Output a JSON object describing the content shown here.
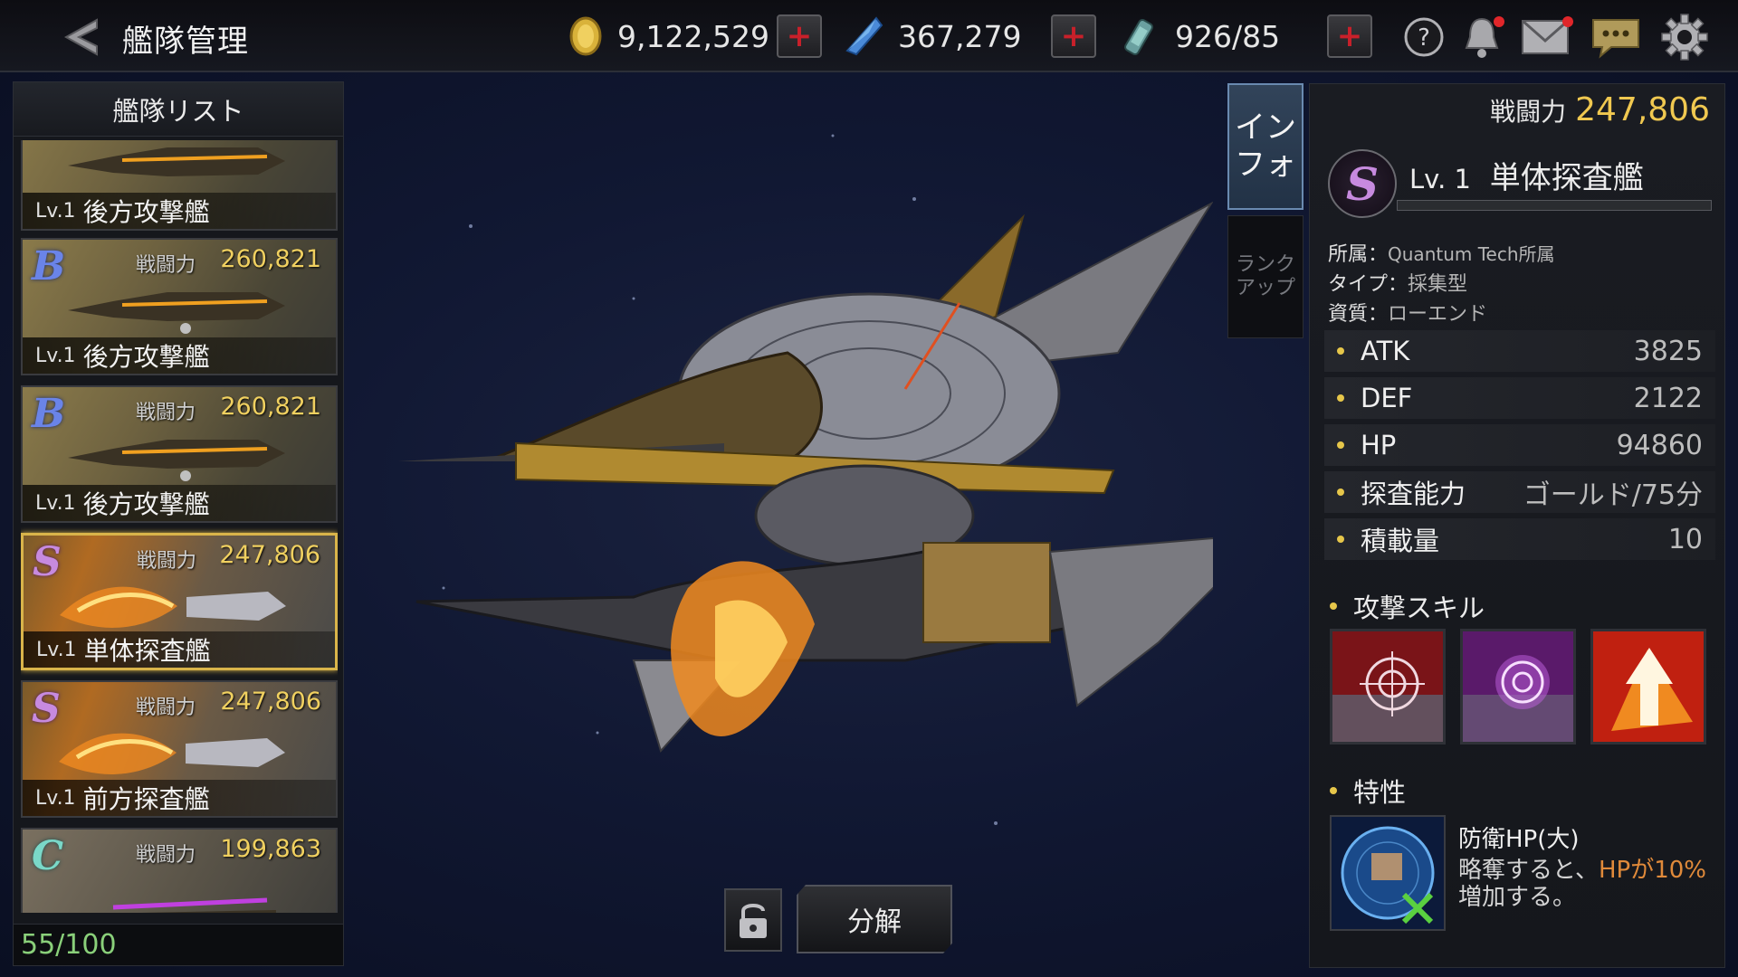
{
  "header": {
    "title": "艦隊管理",
    "gold": "9,122,529",
    "crystal": "367,279",
    "fuel": "926/85"
  },
  "fleet": {
    "header": "艦隊リスト",
    "count": "55/100",
    "power_label": "戦闘力",
    "cards": [
      {
        "rank": "B",
        "lv": "Lv.1",
        "name": "後方攻撃艦",
        "power": "260,821"
      },
      {
        "rank": "B",
        "lv": "Lv.1",
        "name": "後方攻撃艦",
        "power": "260,821"
      },
      {
        "rank": "B",
        "lv": "Lv.1",
        "name": "後方攻撃艦",
        "power": "260,821"
      },
      {
        "rank": "S",
        "lv": "Lv.1",
        "name": "単体探査艦",
        "power": "247,806"
      },
      {
        "rank": "S",
        "lv": "Lv.1",
        "name": "前方探査艦",
        "power": "247,806"
      },
      {
        "rank": "C",
        "lv": "",
        "name": "",
        "power": "199,863"
      }
    ]
  },
  "tabs": {
    "info": "イン\nフォ",
    "rankup": "ランク\nアップ"
  },
  "buttons": {
    "dismantle": "分解"
  },
  "detail": {
    "power_label": "戦闘力",
    "power": "247,806",
    "rank": "S",
    "lv": "Lv. 1",
    "name": "単体探査艦",
    "affiliation_key": "所属：",
    "affiliation": "Quantum Tech所属",
    "type_key": "タイプ：",
    "type": "採集型",
    "quality_key": "資質：",
    "quality": "ローエンド",
    "stats": [
      {
        "name": "ATK",
        "value": "3825"
      },
      {
        "name": "DEF",
        "value": "2122"
      },
      {
        "name": "HP",
        "value": "94860"
      },
      {
        "name": "探査能力",
        "value": "ゴールド/75分"
      },
      {
        "name": "積載量",
        "value": "10"
      }
    ],
    "skills_title": "攻撃スキル",
    "trait_title": "特性",
    "trait_name": "防衛HP(大)",
    "trait_desc_a": "略奪すると、",
    "trait_desc_hl": "HPが10%",
    "trait_desc_b": "増加する。"
  },
  "colors": {
    "accent_gold": "#f0c850",
    "rank_S": "#c78adf",
    "rank_B": "#6a84e8",
    "rank_C": "#7ad8c8",
    "highlight": "#e08a3a"
  }
}
